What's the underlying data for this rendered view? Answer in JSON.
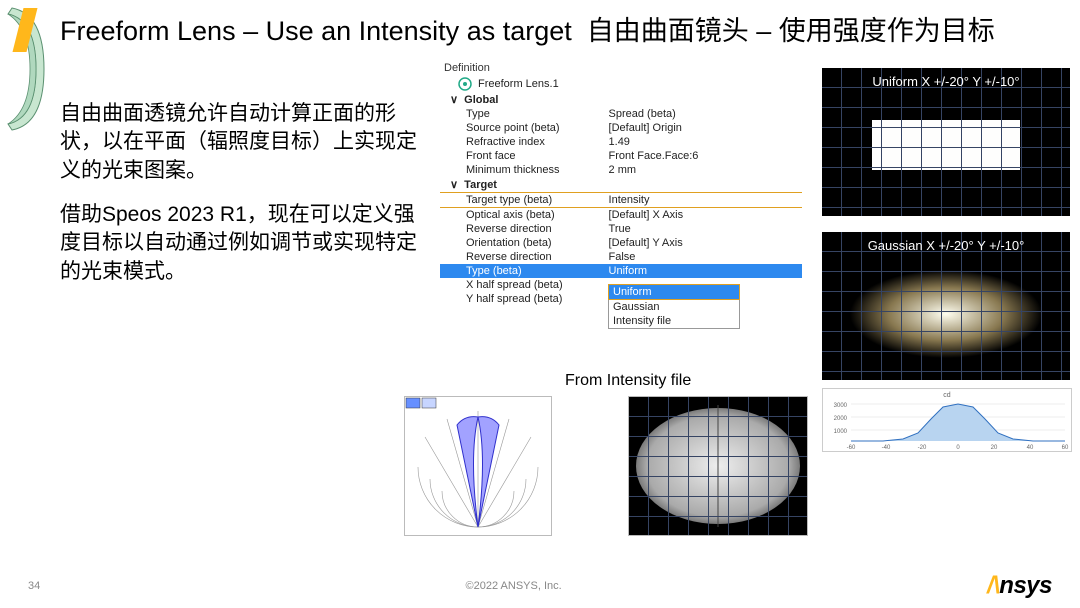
{
  "title_en": "Freeform Lens – Use an Intensity as target",
  "title_zh": "自由曲面镜头 – 使用强度作为目标",
  "para1": "自由曲面透镜允许自动计算正面的形状，以在平面（辐照度目标）上实现定义的光束图案。",
  "para2": "借助Speos 2023 R1，现在可以定义强度目标以自动通过例如调节或实现特定的光束模式。",
  "definition": {
    "header": "Definition",
    "node": "Freeform Lens.1",
    "grp1": "Global",
    "rows1": [
      [
        "Type",
        "Spread (beta)"
      ],
      [
        "Source point (beta)",
        "[Default] Origin"
      ],
      [
        "Refractive index",
        "1.49"
      ],
      [
        "Front face",
        "Front Face.Face:6"
      ],
      [
        "Minimum thickness",
        "2 mm"
      ]
    ],
    "grp2": "Target",
    "rows2": [
      [
        "Target type (beta)",
        "Intensity"
      ],
      [
        "Optical axis (beta)",
        "[Default] X Axis"
      ],
      [
        "Reverse direction",
        "True"
      ],
      [
        "Orientation (beta)",
        "[Default] Y Axis"
      ],
      [
        "Reverse direction",
        "False"
      ],
      [
        "Type (beta)",
        "Uniform"
      ],
      [
        "X half spread (beta)",
        ""
      ],
      [
        "Y half spread (beta)",
        ""
      ]
    ],
    "dropdown": [
      "Uniform",
      "Gaussian",
      "Intensity file"
    ]
  },
  "label_intensity_file": "From Intensity file",
  "img_uniform": "Uniform  X +/-20°  Y +/-10°",
  "img_gaussian": "Gaussian  X +/-20°  Y +/-10°",
  "chart_data": {
    "type": "line",
    "title": "cd",
    "x": [
      -60,
      -50,
      -40,
      -30,
      -20,
      -10,
      0,
      10,
      20,
      30,
      40,
      50,
      60
    ],
    "values": [
      0,
      10,
      80,
      400,
      1400,
      2600,
      3000,
      2600,
      1400,
      400,
      80,
      10,
      0
    ],
    "ylim": [
      0,
      3000
    ],
    "yticks": [
      1000,
      2000,
      3000
    ],
    "xlabel": "",
    "ylabel": ""
  },
  "page_number": "34",
  "copyright": "©2022 ANSYS, Inc.",
  "brand": "Ansys"
}
